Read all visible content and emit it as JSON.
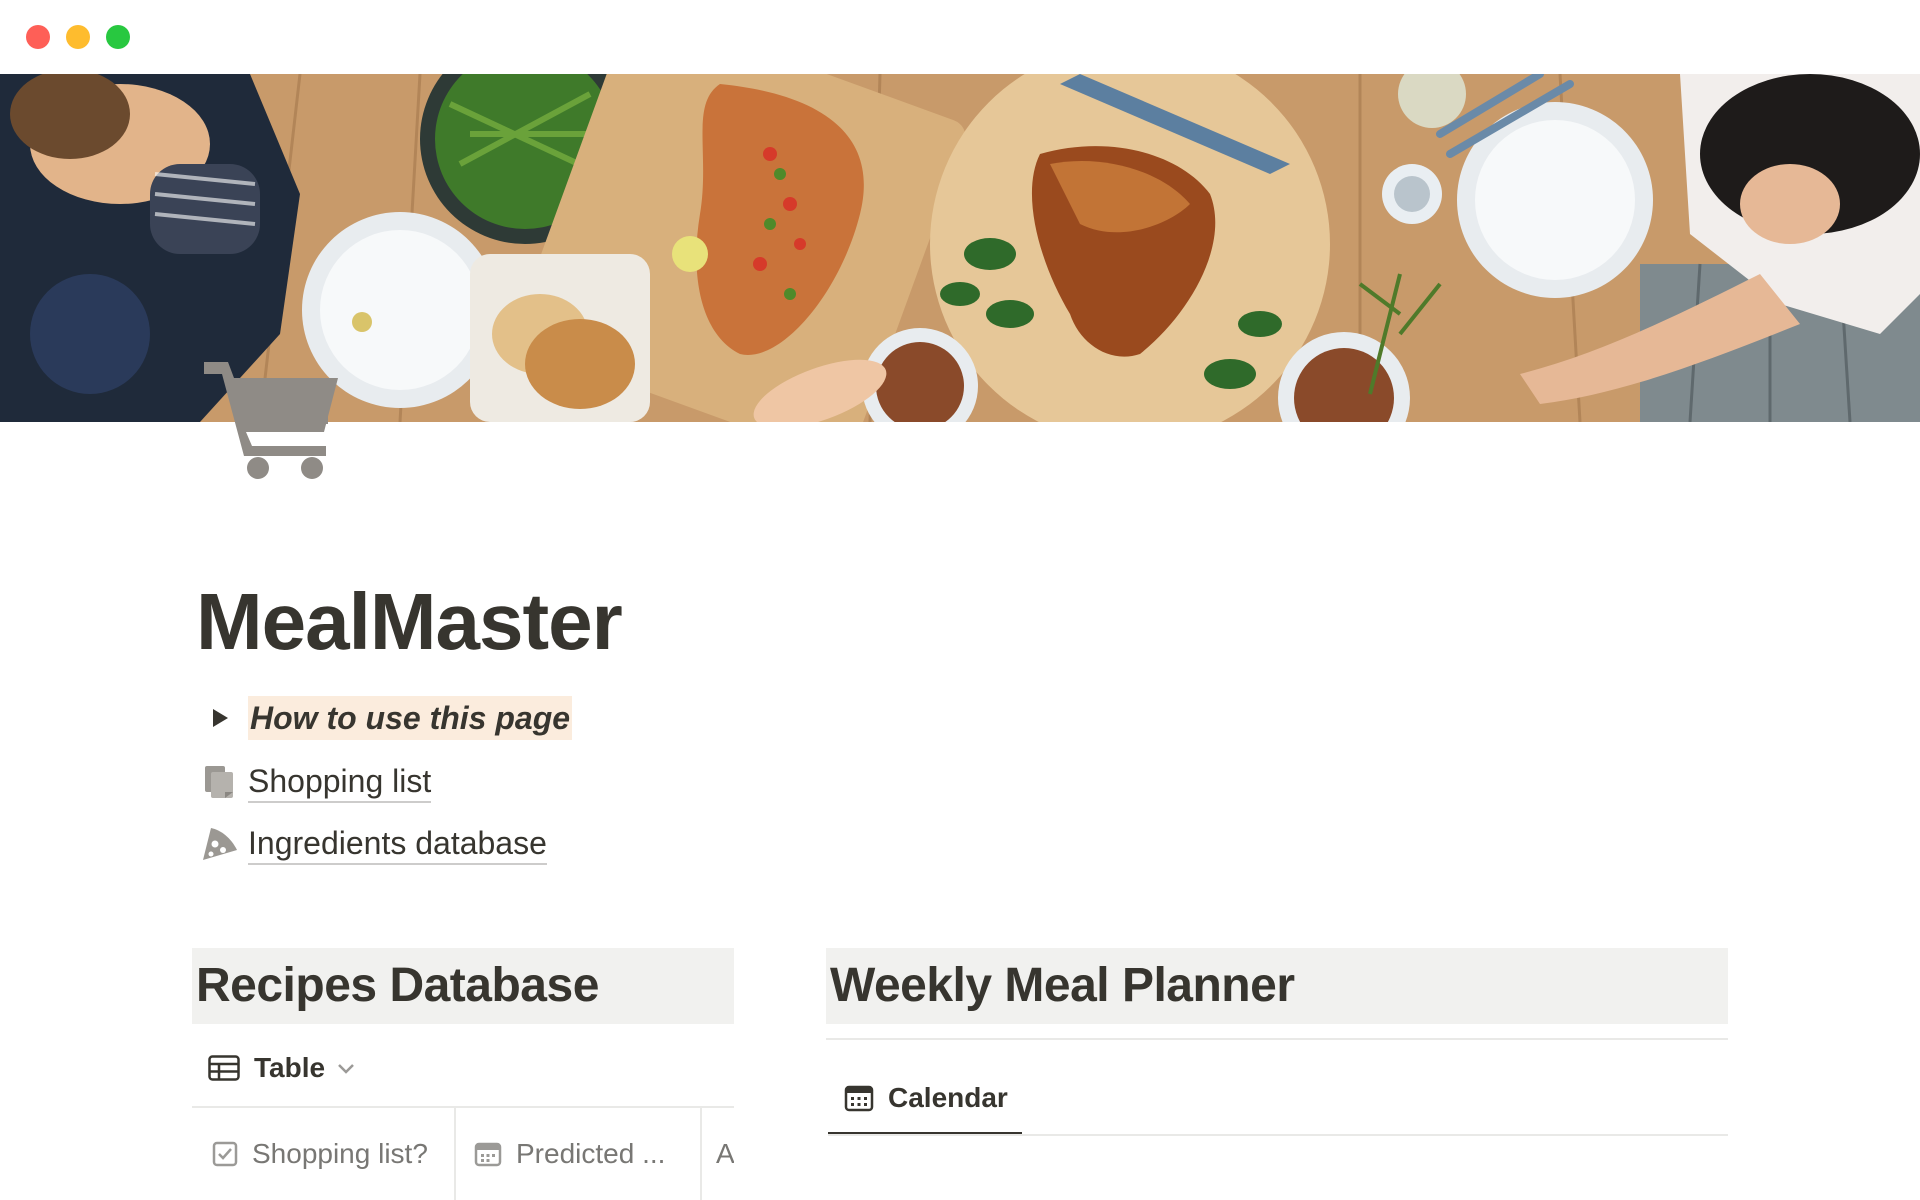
{
  "window": {
    "controls": [
      "close",
      "minimize",
      "zoom"
    ]
  },
  "cover": {
    "description_icon": "dinner-table-cover-image"
  },
  "page": {
    "icon": "shopping-cart-icon",
    "title": "MealMaster"
  },
  "blocks": {
    "toggle": {
      "icon": "triangle-right-icon",
      "label": "How to use this page"
    },
    "links": [
      {
        "icon": "pages-icon",
        "label": "Shopping list"
      },
      {
        "icon": "pizza-icon",
        "label": "Ingredients database"
      }
    ]
  },
  "recipes": {
    "heading": "Recipes Database",
    "view": {
      "icon": "table-icon",
      "label": "Table",
      "chevron": "chevron-down-icon"
    },
    "columns": [
      {
        "icon": "checkbox-icon",
        "label": "Shopping list?"
      },
      {
        "icon": "calendar-icon",
        "label": "Predicted ..."
      },
      {
        "icon": "",
        "label": "A"
      }
    ]
  },
  "planner": {
    "heading": "Weekly Meal Planner",
    "view": {
      "icon": "calendar-icon",
      "label": "Calendar"
    }
  },
  "colors": {
    "text": "#37352f",
    "muted": "#787774",
    "heading_bg": "#f1f1ef",
    "highlight_bg": "#fbecdd",
    "divider": "#e9e9e7"
  }
}
